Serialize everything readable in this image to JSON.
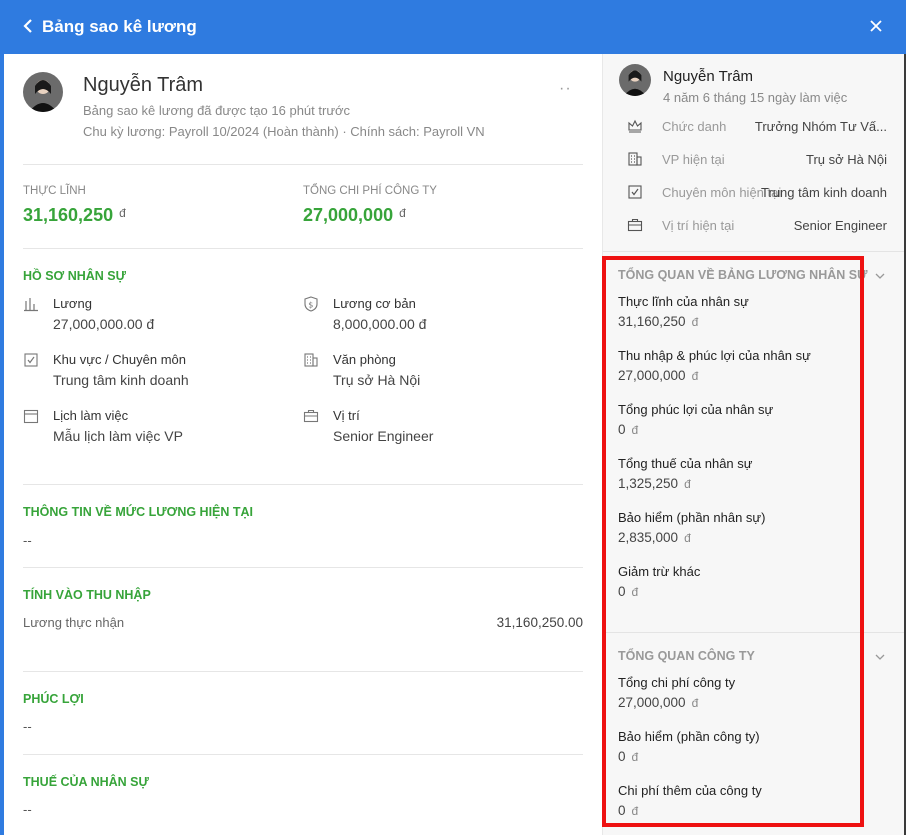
{
  "header": {
    "title": "Bảng sao kê lương"
  },
  "profile": {
    "name": "Nguyễn Trâm",
    "created": "Bảng sao kê lương đã được tạo 16 phút trước",
    "cycle": "Chu kỳ lương: Payroll 10/2024 (Hoàn thành) · Chính sách: Payroll VN",
    "more": "··"
  },
  "summary": {
    "net_label": "THỰC LĨNH",
    "net_value": "31,160,250",
    "cost_label": "TỔNG CHI PHÍ CÔNG TY",
    "cost_value": "27,000,000",
    "currency": "đ"
  },
  "hr_profile": {
    "title": "HỒ SƠ NHÂN SỰ",
    "fields": [
      {
        "label": "Lương",
        "value": "27,000,000.00  đ"
      },
      {
        "label": "Lương cơ bản",
        "value": "8,000,000.00  đ"
      },
      {
        "label": "Khu vực / Chuyên môn",
        "value": "Trung tâm kinh doanh"
      },
      {
        "label": "Văn phòng",
        "value": "Trụ sở Hà Nội"
      },
      {
        "label": "Lịch làm việc",
        "value": "Mẫu lịch làm việc VP"
      },
      {
        "label": "Vị trí",
        "value": "Senior Engineer"
      }
    ]
  },
  "current_salary": {
    "title": "THÔNG TIN VỀ MỨC LƯƠNG HIỆN TẠI",
    "value": "--"
  },
  "income": {
    "title": "TÍNH VÀO THU NHẬP",
    "row_label": "Lương thực nhận",
    "row_value": "31,160,250.00"
  },
  "benefits": {
    "title": "PHÚC LỢI",
    "value": "--"
  },
  "tax": {
    "title": "THUẾ CỦA NHÂN SỰ",
    "value": "--"
  },
  "side": {
    "name": "Nguyễn Trâm",
    "tenure": "4 năm 6 tháng 15 ngày làm việc",
    "info": [
      {
        "icon": "crown-icon",
        "label": "Chức danh",
        "value": "Trưởng Nhóm Tư Vấ..."
      },
      {
        "icon": "building-icon",
        "label": "VP hiện tại",
        "value": "Trụ sở Hà Nội"
      },
      {
        "icon": "checkbox-icon",
        "label": "Chuyên môn hiện tại",
        "value": "Trung tâm kinh doanh"
      },
      {
        "icon": "briefcase-icon",
        "label": "Vị trí hiện tại",
        "value": "Senior Engineer"
      }
    ],
    "employee_overview": {
      "title": "TỔNG QUAN VỀ BẢNG LƯƠNG NHÂN SỰ",
      "items": [
        {
          "label": "Thực lĩnh của nhân sự",
          "value": "31,160,250",
          "unit": "đ"
        },
        {
          "label": "Thu nhập & phúc lợi của nhân sự",
          "value": "27,000,000",
          "unit": "đ"
        },
        {
          "label": "Tổng phúc lợi của nhân sự",
          "value": "0",
          "unit": "đ"
        },
        {
          "label": "Tổng thuế của nhân sự",
          "value": "1,325,250",
          "unit": "đ"
        },
        {
          "label": "Bảo hiểm (phần nhân sự)",
          "value": "2,835,000",
          "unit": "đ"
        },
        {
          "label": "Giảm trừ khác",
          "value": "0",
          "unit": "đ"
        }
      ]
    },
    "company_overview": {
      "title": "TỔNG QUAN CÔNG TY",
      "items": [
        {
          "label": "Tổng chi phí công ty",
          "value": "27,000,000",
          "unit": "đ"
        },
        {
          "label": "Bảo hiểm (phần công ty)",
          "value": "0",
          "unit": "đ"
        },
        {
          "label": "Chi phí thêm của công ty",
          "value": "0",
          "unit": "đ"
        }
      ]
    }
  },
  "colors": {
    "header_blue": "#2f7be0",
    "accent_green": "#37a43a",
    "highlight_red": "#ee1111"
  }
}
